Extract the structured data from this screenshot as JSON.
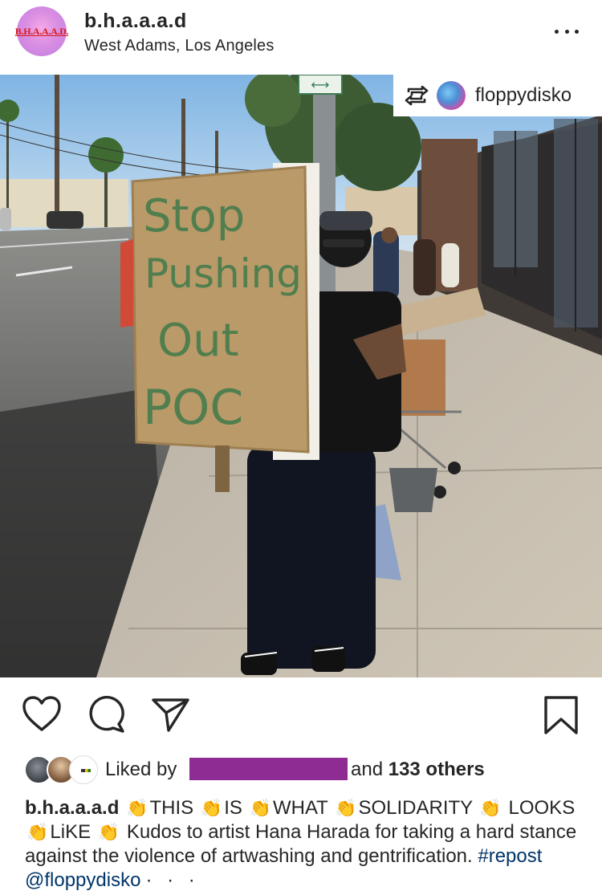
{
  "header": {
    "avatar_text": "B.H.A.A.A.D.",
    "username": "b.h.a.a.a.d",
    "location": "West Adams, Los Angeles"
  },
  "repost": {
    "username": "floppydisko",
    "icon": "repost-icon"
  },
  "photo": {
    "sign_text": [
      "Stop",
      "Pushing",
      "Out",
      "POC"
    ],
    "street_sign_arrow": "⟷"
  },
  "actions": {
    "icons": [
      "heart-icon",
      "comment-icon",
      "share-icon",
      "bookmark-icon"
    ]
  },
  "likes": {
    "prefix": "Liked by",
    "suffix": "and",
    "count_text": "133 others"
  },
  "caption": {
    "username": "b.h.a.a.a.d",
    "words": [
      "THIS",
      "IS",
      "WHAT",
      "SOLIDARITY",
      "LOOKS",
      "LiKE"
    ],
    "clap": "👏",
    "body": "Kudos to artist Hana Harada for taking a hard stance against the violence of artwashing and gentrification.",
    "hashtag": "#repost",
    "mention": "@floppydisko",
    "more": "· · ·"
  },
  "colors": {
    "text": "#262626",
    "link": "#003569",
    "redaction": "#8e2c94"
  }
}
